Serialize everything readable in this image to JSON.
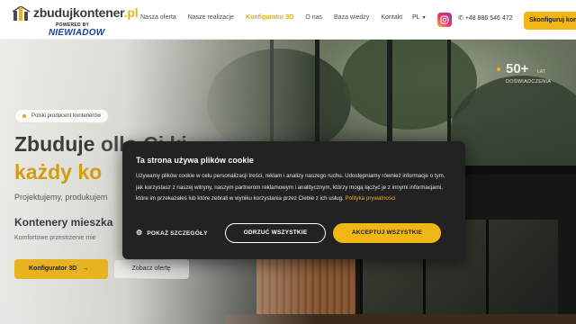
{
  "header": {
    "logo_text_main": "zbuduj",
    "logo_text_bold": "kontener",
    "logo_text_domain": ".pl",
    "powered_by": "POWERED BY",
    "partner_logo": "NIEWIADOW",
    "nav": [
      {
        "label": "Nasza oferta",
        "active": false
      },
      {
        "label": "Nasze realizacje",
        "active": false
      },
      {
        "label": "Konfigurator 3D",
        "active": true
      },
      {
        "label": "O nas",
        "active": false
      },
      {
        "label": "Baza wiedzy",
        "active": false
      },
      {
        "label": "Kontakt",
        "active": false
      }
    ],
    "language": "PL",
    "instagram_icon": "instagram-icon",
    "phone_icon": "phone-icon",
    "phone": "+48 886 546 472",
    "cta_label": "Skonfiguruj kontener"
  },
  "hero": {
    "badge": "Polski producent kontenerów",
    "heading_line1": "Zbuduje",
    "heading_line1_tail": "ollo Ci ki",
    "heading_line2": "każdy ko",
    "lead": "Projektujemy, produkujem",
    "subheading": "Kontenery mieszka",
    "subtext": "Komfortowe przestrzenie mie",
    "primary_button": "Konfigurator 3D",
    "secondary_button": "Zobacz ofertę",
    "stat_number": "50+",
    "stat_unit": "LAT",
    "stat_label": "DOŚWIADCZENIA",
    "accent_color": "#e8b320"
  },
  "cookie_modal": {
    "title": "Ta strona używa plików cookie",
    "body": "Używamy plików cookie w celu personalizacji treści, reklam i analizy naszego ruchu. Udostępniamy również informacje o tym, jak korzystasz z naszej witryny, naszym partnerom reklamowym i analitycznym, którzy mogą łączyć je z innymi informacjami, które im przekazałeś lub które zebrali w wyniku korzystania przez Ciebie z ich usług.",
    "privacy_link": "Polityka prywatności",
    "details_label": "POKAŻ SZCZEGÓŁY",
    "reject_label": "ODRZUĆ WSZYSTKIE",
    "accept_label": "AKCEPTUJ WSZYSTKIE"
  }
}
